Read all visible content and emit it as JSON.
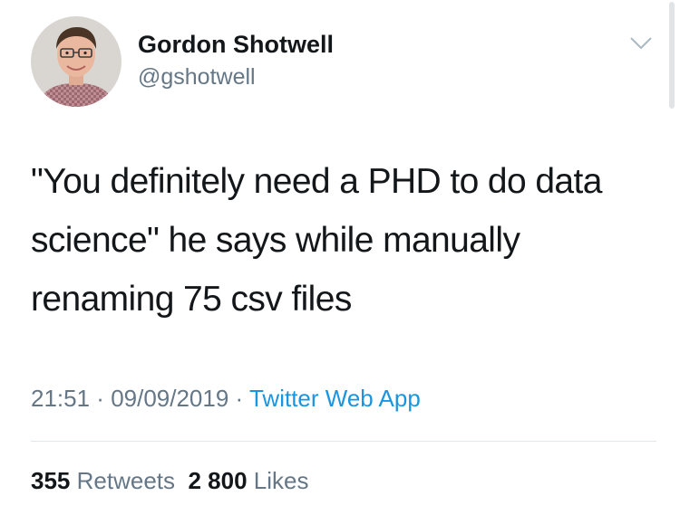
{
  "author": {
    "name": "Gordon Shotwell",
    "handle": "@gshotwell",
    "avatar_icon": "person-portrait-icon"
  },
  "tweet": {
    "text": "\"You definitely need a PHD to do data science\" he says while manually renaming 75 csv files"
  },
  "meta": {
    "time": "21:51",
    "separator_1": " · ",
    "date": "09/09/2019",
    "separator_2": " · ",
    "source": "Twitter Web App"
  },
  "stats": {
    "retweets_count": "355",
    "retweets_label": "Retweets",
    "likes_count": "2 800",
    "likes_label": "Likes"
  },
  "colors": {
    "text": "#14171a",
    "secondary": "#657786",
    "link": "#1b95e0",
    "divider": "#e1e8ed"
  },
  "icons": {
    "menu": "chevron-down-icon"
  }
}
